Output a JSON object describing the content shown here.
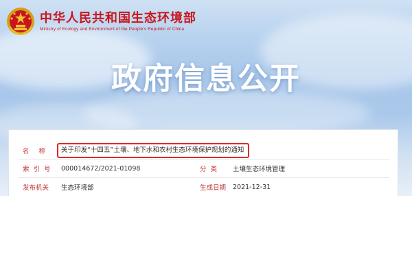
{
  "header": {
    "ministry_cn": "中华人民共和国生态环境部",
    "ministry_en": "Ministry of Ecology and Environment of the People's Republic of China",
    "emblem_icon": "national-emblem-icon"
  },
  "banner": {
    "title": "政府信息公开"
  },
  "info": {
    "name_label": "名称",
    "name_value": "关于印发“十四五”土壤、地下水和农村生态环境保护规划的通知",
    "index_label": "索引号",
    "index_value": "000014672/2021-01098",
    "category_label": "分类",
    "category_value": "土壤生态环境管理",
    "issuer_label": "发布机关",
    "issuer_value": "生态环境部",
    "date_label": "生成日期",
    "date_value": "2021-12-31"
  },
  "colors": {
    "ministry_red": "#c8161d",
    "label_red": "#c0393b",
    "highlight_border": "#e02727"
  }
}
